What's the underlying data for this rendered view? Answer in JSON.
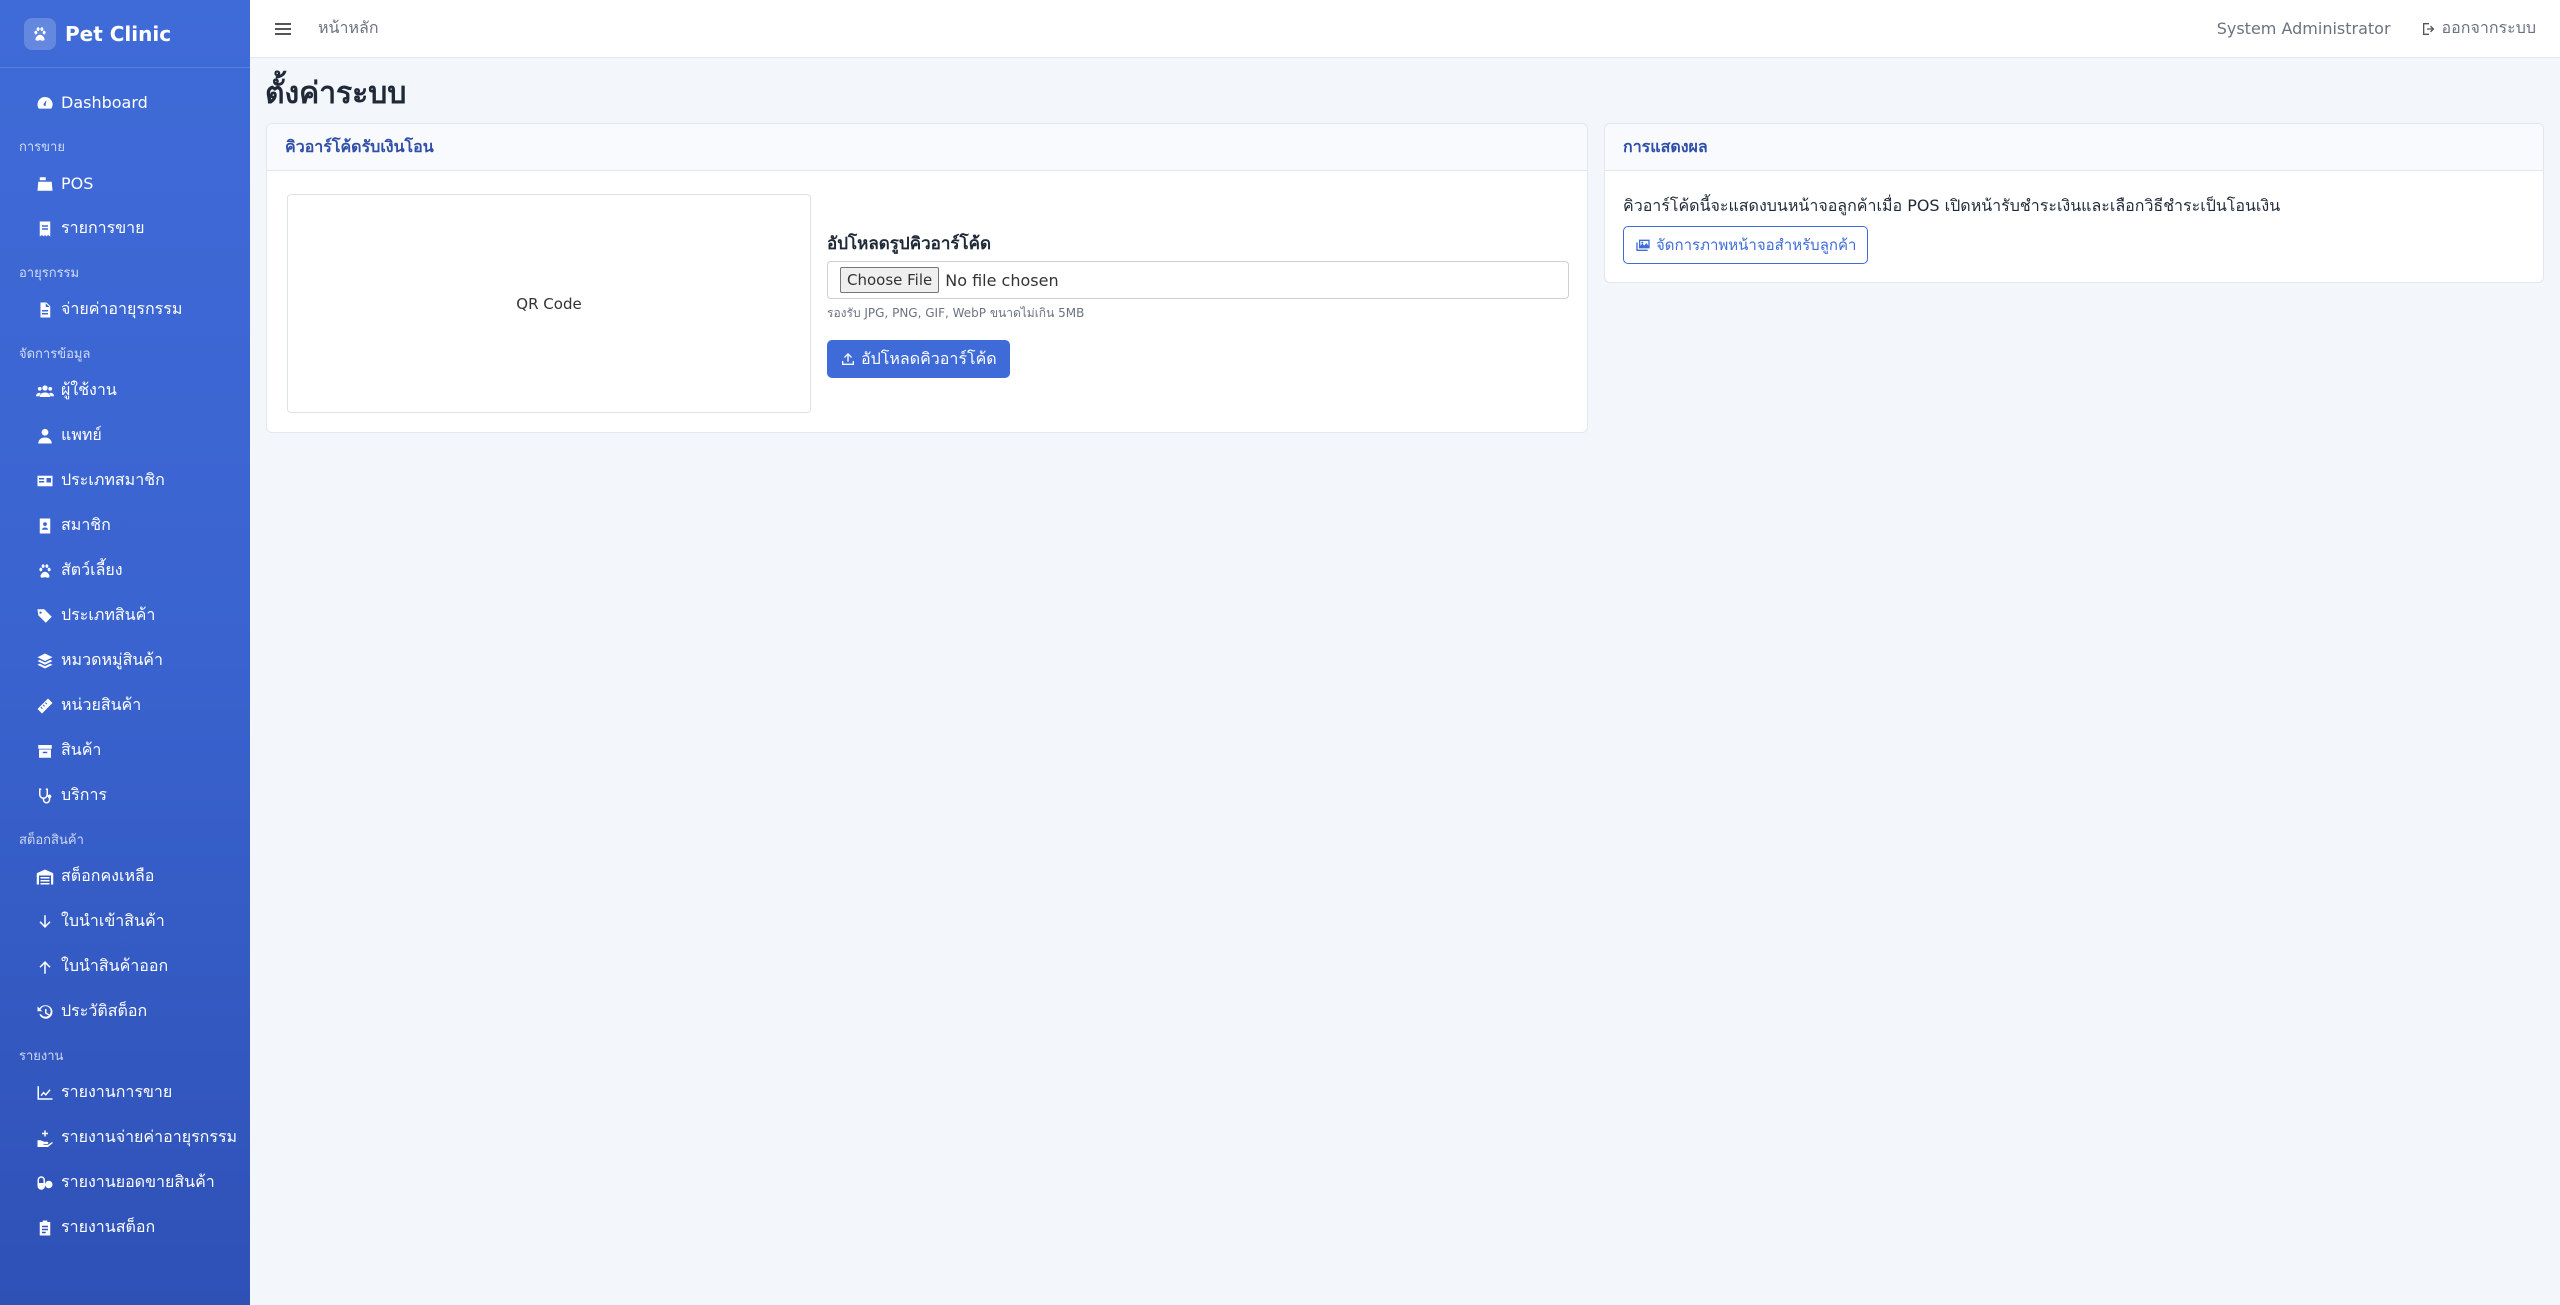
{
  "brand": {
    "name": "Pet Clinic"
  },
  "sidebar": {
    "dashboard": "Dashboard",
    "sections": [
      {
        "title": "การขาย",
        "items": [
          "POS",
          "รายการขาย"
        ]
      },
      {
        "title": "อายุรกรรม",
        "items": [
          "จ่ายค่าอายุรกรรม"
        ]
      },
      {
        "title": "จัดการข้อมูล",
        "items": [
          "ผู้ใช้งาน",
          "แพทย์",
          "ประเภทสมาชิก",
          "สมาชิก",
          "สัตว์เลี้ยง",
          "ประเภทสินค้า",
          "หมวดหมู่สินค้า",
          "หน่วยสินค้า",
          "สินค้า",
          "บริการ"
        ]
      },
      {
        "title": "สต็อกสินค้า",
        "items": [
          "สต็อกคงเหลือ",
          "ใบนำเข้าสินค้า",
          "ใบนำสินค้าออก",
          "ประวัติสต็อก"
        ]
      },
      {
        "title": "รายงาน",
        "items": [
          "รายงานการขาย",
          "รายงานจ่ายค่าอายุรกรรม",
          "รายงานยอดขายสินค้า",
          "รายงานสต็อก"
        ]
      }
    ]
  },
  "topbar": {
    "breadcrumb": "หน้าหลัก",
    "user": "System Administrator",
    "logout": "ออกจากระบบ"
  },
  "page": {
    "title": "ตั้งค่าระบบ"
  },
  "qr_card": {
    "header": "คิวอาร์โค้ดรับเงินโอน",
    "image_alt": "QR Code",
    "upload_label": "อัปโหลดรูปคิวอาร์โค้ด",
    "file_button": "Choose File",
    "file_status": "No file chosen",
    "hint": "รองรับ JPG, PNG, GIF, WebP ขนาดไม่เกิน 5MB",
    "upload_button": "อัปโหลดคิวอาร์โค้ด"
  },
  "display_card": {
    "header": "การแสดงผล",
    "text": "คิวอาร์โค้ดนี้จะแสดงบนหน้าจอลูกค้าเมื่อ POS เปิดหน้ารับชำระเงินและเลือกวิธีชำระเป็นโอนเงิน",
    "manage_button": "จัดการภาพหน้าจอสำหรับลูกค้า"
  }
}
